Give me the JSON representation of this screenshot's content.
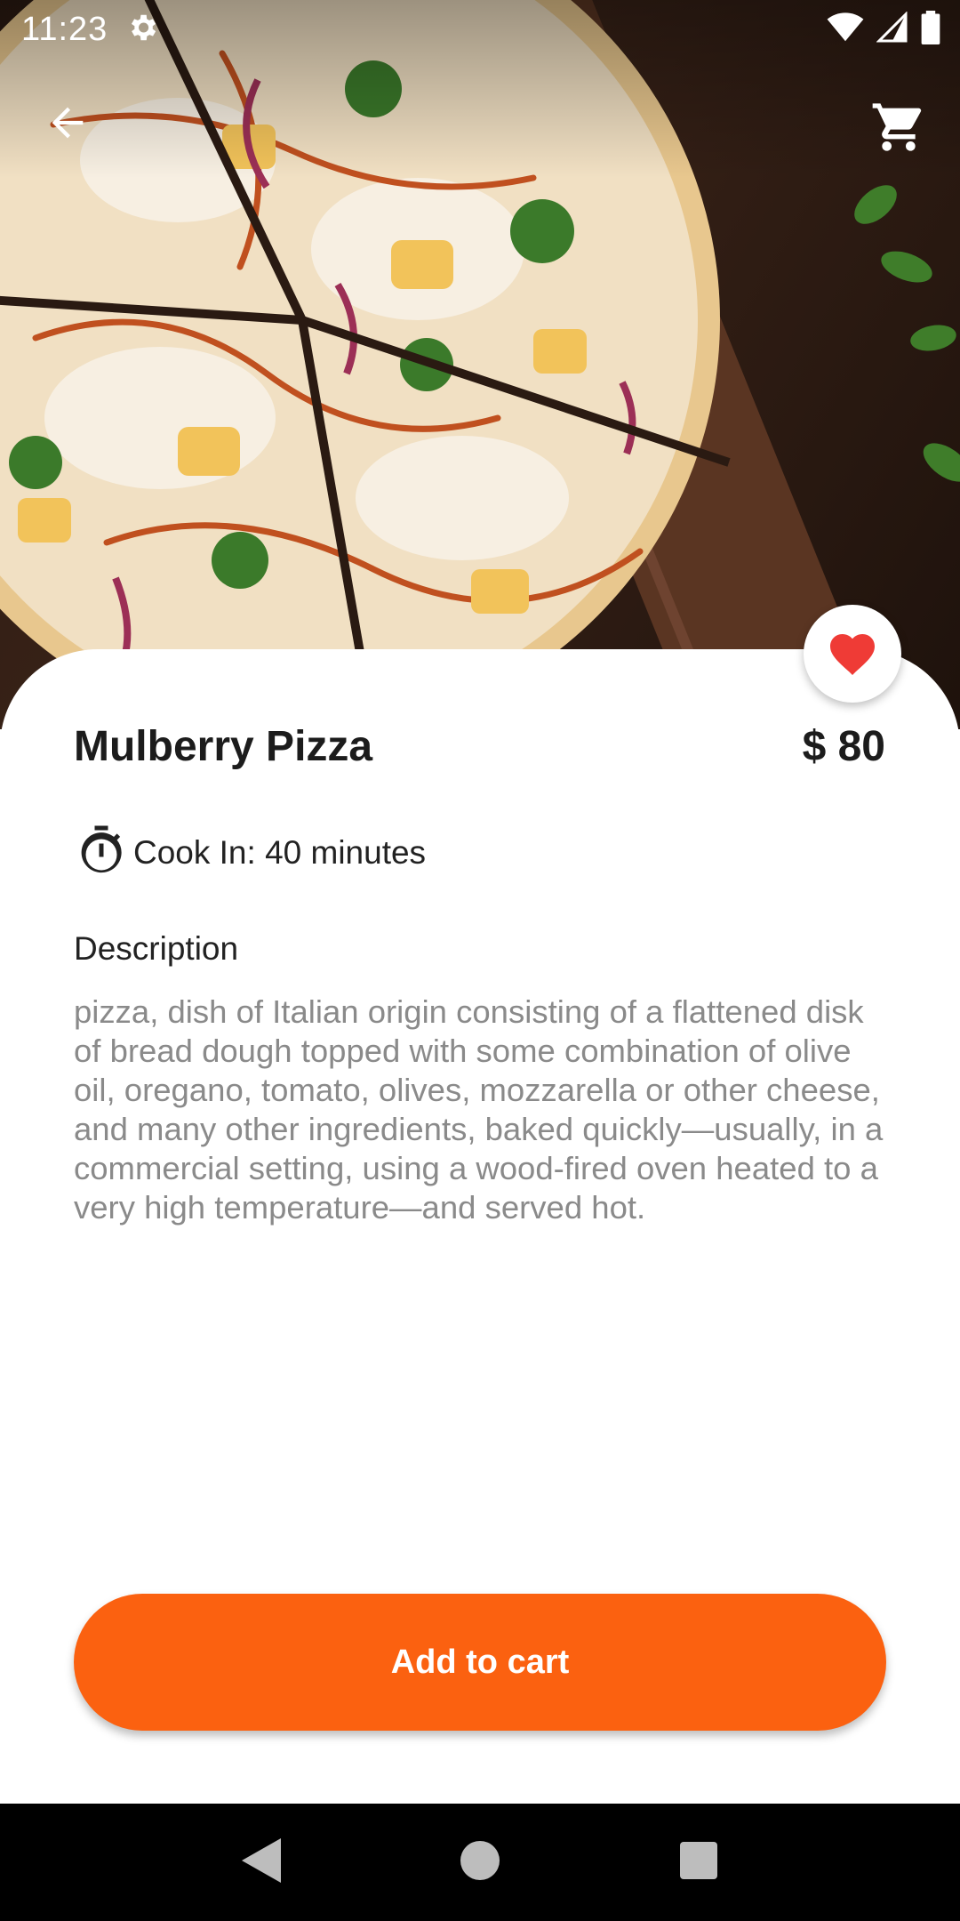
{
  "status_bar": {
    "time": "11:23",
    "icons": [
      "settings-icon",
      "wifi-icon",
      "cellular-signal-icon",
      "battery-icon"
    ]
  },
  "app_bar": {
    "back_icon": "arrow-back-icon",
    "cart_icon": "shopping-cart-icon"
  },
  "hero": {
    "image": "pizza-photo"
  },
  "product": {
    "name": "Mulberry Pizza",
    "price": "$ 80",
    "favorite_icon": "heart-icon",
    "favorited": true,
    "cook_time_icon": "timer-icon",
    "cook_time": "Cook In: 40 minutes",
    "description_heading": "Description",
    "description": "pizza, dish of Italian origin consisting of a flattened disk of bread dough topped with some combination of olive oil, oregano, tomato, olives, mozzarella or other cheese, and many other ingredients, baked quickly—usually, in a commercial setting, using a wood-fired oven heated to a very high temperature—and served hot."
  },
  "actions": {
    "add_to_cart": "Add to cart"
  },
  "nav_bar": {
    "buttons": [
      "back-triangle-icon",
      "home-circle-icon",
      "recents-square-icon"
    ]
  },
  "colors": {
    "accent": "#fb6110",
    "favorite": "#ef3b36",
    "title_text": "#1c1c1c",
    "body_text": "#8a8a8a"
  }
}
